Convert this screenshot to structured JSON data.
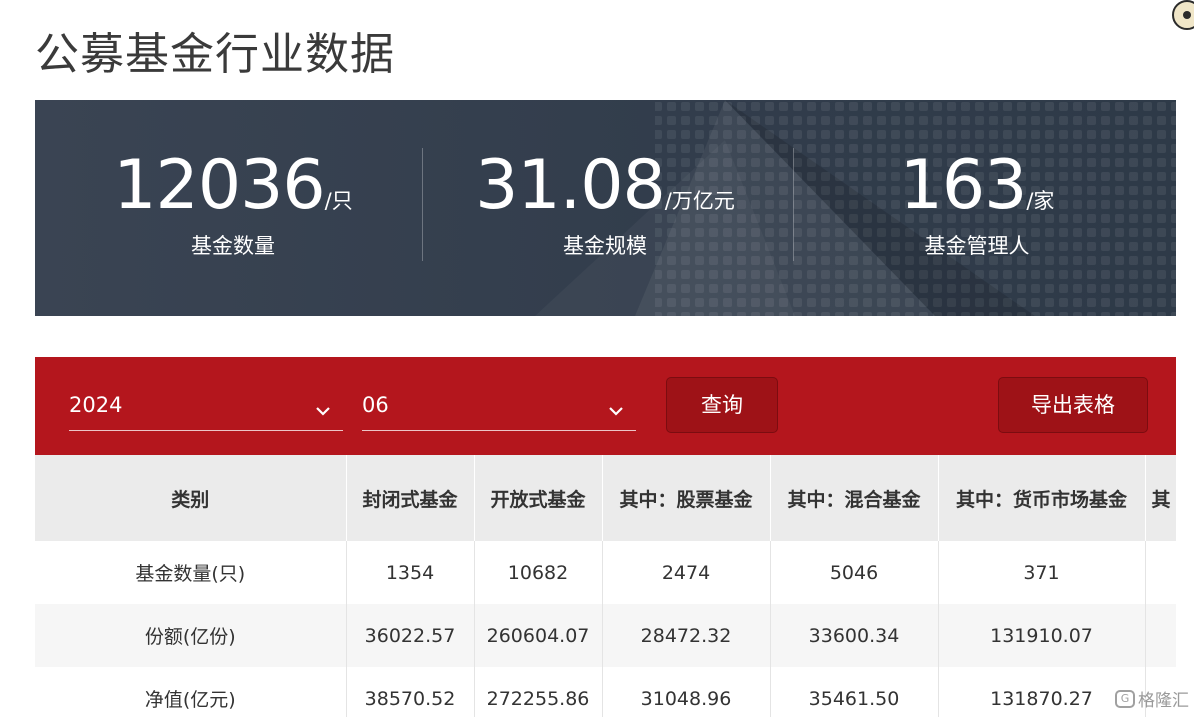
{
  "page": {
    "title": "公募基金行业数据"
  },
  "summary": [
    {
      "value": "12036",
      "unit": "/只",
      "label": "基金数量"
    },
    {
      "value": "31.08",
      "unit": "/万亿元",
      "label": "基金规模"
    },
    {
      "value": "163",
      "unit": "/家",
      "label": "基金管理人"
    }
  ],
  "filters": {
    "year": {
      "value": "2024"
    },
    "month": {
      "value": "06"
    },
    "query_label": "查询",
    "export_label": "导出表格"
  },
  "table": {
    "headers": [
      "类别",
      "封闭式基金",
      "开放式基金",
      "其中：股票基金",
      "其中：混合基金",
      "其中：货币市场基金",
      "其"
    ],
    "rows": [
      [
        "基金数量(只)",
        "1354",
        "10682",
        "2474",
        "5046",
        "371",
        ""
      ],
      [
        "份额(亿份)",
        "36022.57",
        "260604.07",
        "28472.32",
        "33600.34",
        "131910.07",
        ""
      ],
      [
        "净值(亿元)",
        "38570.52",
        "272255.86",
        "31048.96",
        "35461.50",
        "131870.27",
        ""
      ]
    ]
  },
  "watermark": {
    "text": "格隆汇",
    "icon": "G"
  },
  "colors": {
    "banner": "#323d4c",
    "accent_red": "#b4161d",
    "header_bg": "#ebebeb"
  }
}
